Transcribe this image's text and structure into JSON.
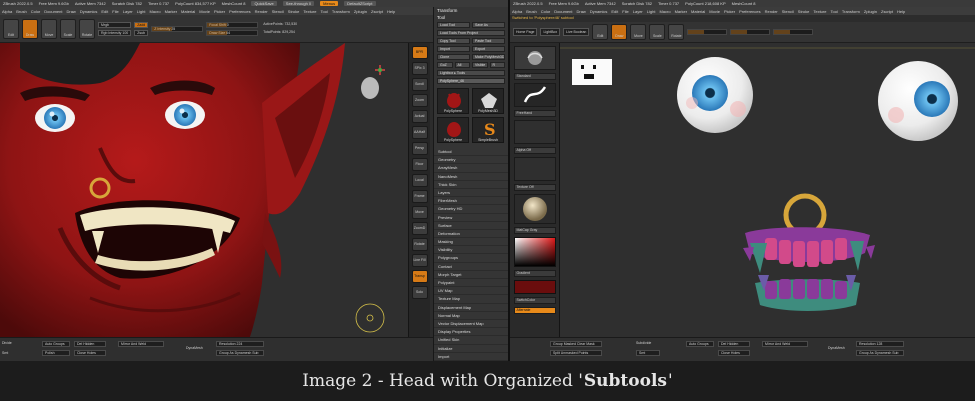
{
  "left_window": {
    "titlebar": [
      "ZBrush 2022.0.5",
      "Free Mem 9.6Gb",
      "Active Mem 7342",
      "Scratch Disk 782",
      "Timer 0.737",
      "PolyCount 834,577 KP",
      "MeshCount 8"
    ],
    "titlebar_buttons": [
      "QuickSave",
      "See-through 0",
      "Menus",
      "DefaultZScript"
    ],
    "menus": [
      "Alpha",
      "Brush",
      "Color",
      "Document",
      "Draw",
      "Dynamics",
      "Edit",
      "File",
      "Layer",
      "Light",
      "Macro",
      "Marker",
      "Material",
      "Movie",
      "Picker",
      "Preferences",
      "Render",
      "Stencil",
      "Stroke",
      "Texture",
      "Tool",
      "Transform",
      "Zplugin",
      "Zscript",
      "Help"
    ],
    "shelf_buttons": [
      "Edit",
      "Draw",
      "Move",
      "Scale",
      "Rotate"
    ],
    "shelf_fields": {
      "mrgb": "Mrgb",
      "rgb": "Rgb",
      "m": "M",
      "zadd": "Zadd",
      "zsub": "Zsub",
      "rgb_intensity": "Rgb Intensity 100",
      "z_intensity": "Z Intensity 25",
      "focal_shift": "Focal Shift 0",
      "draw_size": "Draw Size 64",
      "dynamic": "Dynamic",
      "active_points": "ActivePoints: 732,530",
      "total_points": "TotalPoints: 829,254"
    },
    "right_tools": [
      "BPR",
      "SPix 3",
      "Scroll",
      "Zoom",
      "Actual",
      "AAHalf",
      "Persp",
      "Floor",
      "Local",
      "Frame",
      "Move",
      "ZoomD",
      "Rotate",
      "Line Fill",
      "Transp",
      "Solo"
    ],
    "bottom": {
      "dynamesh": "DynaMesh",
      "resolution": "Resolution 224",
      "group": "Groups",
      "polish": "Polish",
      "auto_groups": "Auto Groups",
      "del_hidden": "Del Hidden",
      "close_holes": "Close Holes",
      "mirror_weld": "Mirror And Weld",
      "group_as_dynamesh": "Group As Dynamesh Sub",
      "subdiv": "Divide",
      "smt": "Smt"
    }
  },
  "tool_panel": {
    "title": "Transform",
    "tool_header": "Tool",
    "buttons": [
      [
        "Load Tool",
        "Save As"
      ],
      [
        "Load Tools From Project"
      ],
      [
        "Copy Tool",
        "Paste Tool"
      ],
      [
        "Import",
        "Export"
      ],
      [
        "Clone",
        "Make PolyMesh3D"
      ],
      [
        "GoZ",
        "All",
        "Visible",
        "R"
      ]
    ],
    "lightbox": "Lightbox ▸ Tools",
    "current_tool": "PolySphere_46",
    "thumbs": [
      "PolySphere",
      "PolyMesh3D",
      "PolySphere",
      "SimpleBrush"
    ],
    "thumbs_count": "46",
    "sections": [
      "Subtool",
      "Geometry",
      "ArrayMesh",
      "NanoMesh",
      "Thick Skin",
      "Layers",
      "FiberMesh",
      "Geometry HD",
      "Preview",
      "Surface",
      "Deformation",
      "Masking",
      "Visibility",
      "Polygroups",
      "Contact",
      "Morph Target",
      "Polypaint",
      "UV Map",
      "Texture Map",
      "Displacement Map",
      "Normal Map",
      "Vector Displacement Map",
      "Display Properties",
      "Unified Skin",
      "Initialize",
      "Import",
      "Export"
    ]
  },
  "right_window": {
    "titlebar": [
      "ZBrush 2022.0.5",
      "Free Mem 9.6Gb",
      "Active Mem 7342",
      "Scratch Disk 782",
      "Timer 0.737",
      "PolyCount 218,608 KP",
      "MeshCount 8"
    ],
    "subtitle": "Switched to 'Polysphere46' subtool",
    "menus": [
      "Alpha",
      "Brush",
      "Color",
      "Document",
      "Draw",
      "Dynamics",
      "Edit",
      "File",
      "Layer",
      "Light",
      "Macro",
      "Marker",
      "Material",
      "Movie",
      "Picker",
      "Preferences",
      "Render",
      "Stencil",
      "Stroke",
      "Texture",
      "Tool",
      "Transform",
      "Zplugin",
      "Zscript",
      "Help"
    ],
    "home_page": "Home Page",
    "lightbox": "LightBox",
    "live_boolean": "Live Boolean",
    "shelf_buttons": [
      "Edit",
      "Draw",
      "Move",
      "Scale",
      "Rotate"
    ],
    "left_dock": [
      "Standard",
      "FreeHand",
      "Alpha Off",
      "Texture Off",
      "MatCap Gray",
      "Gradient",
      "SwitchColor",
      "Alternate"
    ],
    "bottom": {
      "subdivide": "Subdivide",
      "smt": "Smt",
      "divide": "Divide",
      "group_masked": "Group Masked Clear Mask",
      "split_unmasked": "Split Unmasked Points",
      "auto_groups": "Auto Groups",
      "del_hidden": "Del Hidden",
      "close_holes": "Close Holes",
      "mirror_weld": "Mirror And Weld",
      "dynamesh": "DynaMesh",
      "resolution": "Resolution 128",
      "group_as_dynamesh": "Group As Dynamesh Sub"
    }
  },
  "caption": {
    "prefix": "Image 2 - Head with Organized '",
    "emphasis": "Subtools",
    "suffix": "'"
  },
  "colors": {
    "skin": "#8e1414",
    "accent": "#e88a1a",
    "iris": "#3d9ee0",
    "gold": "#d7a63a",
    "gums": "#8a3a9a",
    "teeth_tips": "#3e8c7e"
  }
}
